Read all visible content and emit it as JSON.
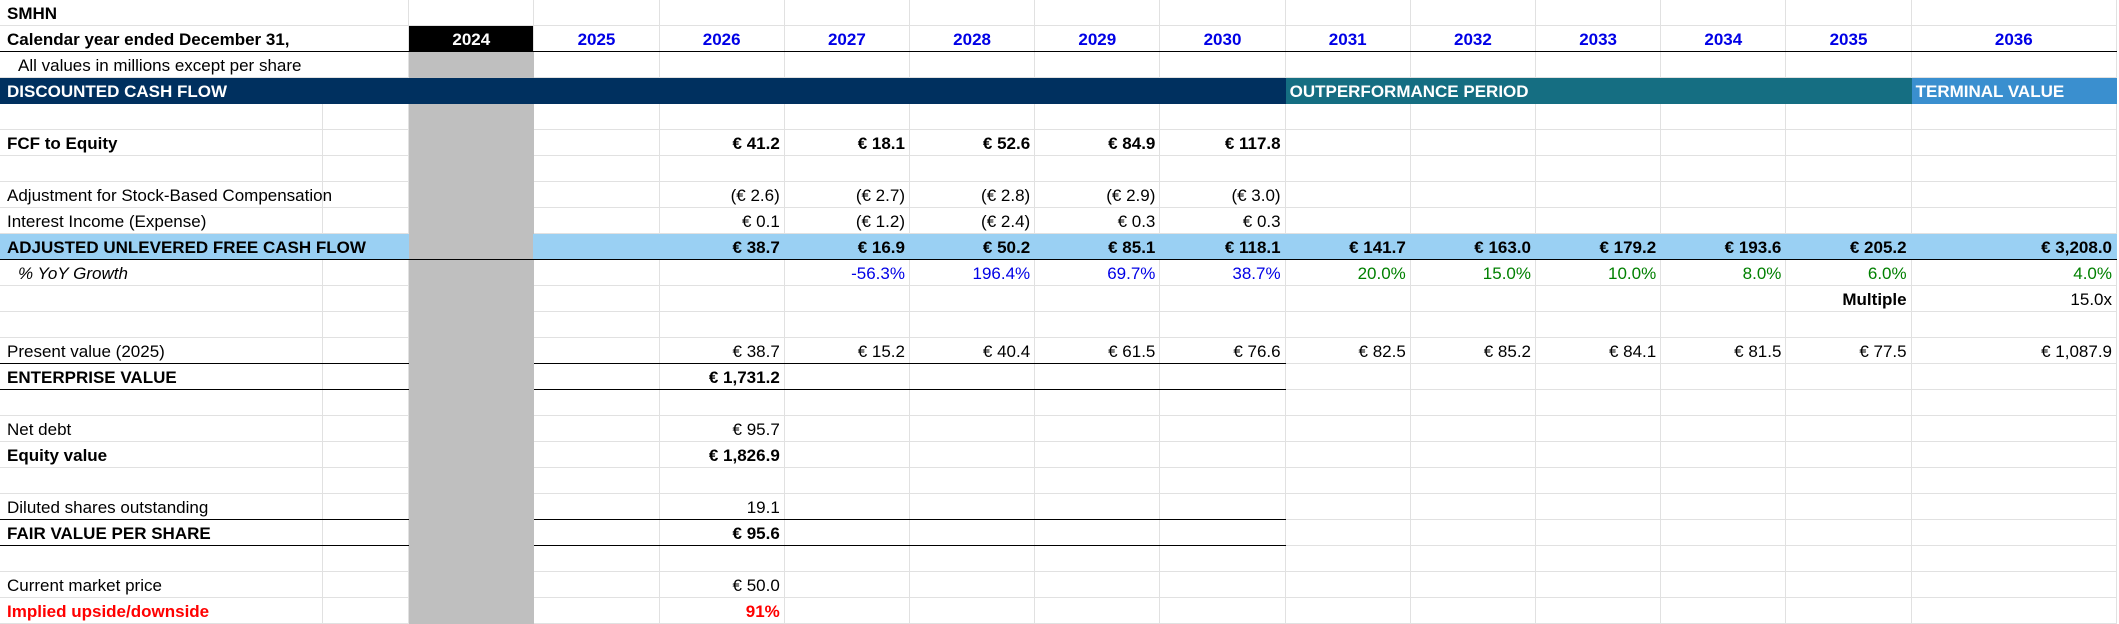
{
  "ticker": "SMHN",
  "period_label": "Calendar year ended December 31,",
  "units_note": "All values in millions except per share",
  "years": [
    "2024",
    "2025",
    "2026",
    "2027",
    "2028",
    "2029",
    "2030",
    "2031",
    "2032",
    "2033",
    "2034",
    "2035",
    "2036"
  ],
  "bands": {
    "dcf": "DISCOUNTED CASH FLOW",
    "outperformance": "OUTPERFORMANCE PERIOD",
    "terminal": "TERMINAL VALUE"
  },
  "fcf_to_equity": {
    "label": "FCF to Equity",
    "values": [
      "€ 41.2",
      "€ 18.1",
      "€ 52.6",
      "€ 84.9",
      "€ 117.8"
    ]
  },
  "sbc_adjustment": {
    "label": "Adjustment for Stock-Based Compensation",
    "values": [
      "(€ 2.6)",
      "(€ 2.7)",
      "(€ 2.8)",
      "(€ 2.9)",
      "(€ 3.0)"
    ]
  },
  "interest": {
    "label": "Interest Income (Expense)",
    "values": [
      "€ 0.1",
      "(€ 1.2)",
      "(€ 2.4)",
      "€ 0.3",
      "€ 0.3"
    ]
  },
  "adj_ufcf": {
    "label": "ADJUSTED UNLEVERED FREE CASH FLOW",
    "values": [
      "€ 38.7",
      "€ 16.9",
      "€ 50.2",
      "€ 85.1",
      "€ 118.1",
      "€ 141.7",
      "€ 163.0",
      "€ 179.2",
      "€ 193.6",
      "€ 205.2",
      "€ 3,208.0"
    ]
  },
  "yoy_growth": {
    "label": "% YoY Growth",
    "forecast": [
      "-56.3%",
      "196.4%",
      "69.7%",
      "38.7%"
    ],
    "outperformance": [
      "20.0%",
      "15.0%",
      "10.0%",
      "8.0%",
      "6.0%"
    ],
    "terminal": "4.0%"
  },
  "multiple": {
    "label": "Multiple",
    "value": "15.0x"
  },
  "present_value": {
    "label": "Present value (2025)",
    "values": [
      "€ 38.7",
      "€ 15.2",
      "€ 40.4",
      "€ 61.5",
      "€ 76.6",
      "€ 82.5",
      "€ 85.2",
      "€ 84.1",
      "€ 81.5",
      "€ 77.5",
      "€ 1,087.9"
    ]
  },
  "enterprise_value": {
    "label": "ENTERPRISE VALUE",
    "value": "€ 1,731.2"
  },
  "net_debt": {
    "label": "Net debt",
    "value": "€ 95.7"
  },
  "equity_value": {
    "label": "Equity value",
    "value": "€ 1,826.9"
  },
  "diluted_shares": {
    "label": "Diluted shares outstanding",
    "value": "19.1"
  },
  "fair_value": {
    "label": "FAIR VALUE PER SHARE",
    "value": "€ 95.6"
  },
  "market_price": {
    "label": "Current market price",
    "value": "€ 50.0"
  },
  "upside": {
    "label": "Implied upside/downside",
    "value": "91%"
  },
  "colors": {
    "navy_band": "#00305f",
    "teal_band": "#156e82",
    "terminal_band": "#3a8fcf",
    "light_blue_row": "#9ad0f3",
    "gray_column": "#bfbfbf",
    "year_blue": "#0000e6",
    "growth_green": "#008000",
    "upside_red": "#ff0000"
  }
}
